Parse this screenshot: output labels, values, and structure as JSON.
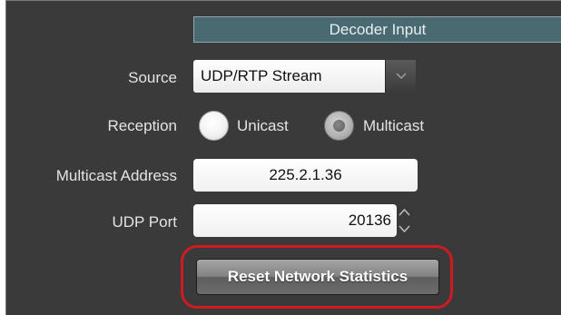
{
  "panel": {
    "header_title": "Decoder Input"
  },
  "source": {
    "label": "Source",
    "value": "UDP/RTP Stream",
    "arrow_icon": "chevron-down-icon"
  },
  "reception": {
    "label": "Reception",
    "options": [
      {
        "label": "Unicast",
        "selected": false
      },
      {
        "label": "Multicast",
        "selected": true
      }
    ]
  },
  "multicast_address": {
    "label": "Multicast Address",
    "value": "225.2.1.36"
  },
  "udp_port": {
    "label": "UDP Port",
    "value": "20136",
    "stepper_icons": [
      "arrow-up-icon",
      "arrow-down-icon"
    ]
  },
  "reset_button": {
    "label": "Reset Network Statistics"
  },
  "colors": {
    "panel_bg": "#3a3a3a",
    "header_bg": "#4a6a72",
    "highlight": "#d01a22",
    "label_text": "#e4e4e4"
  }
}
